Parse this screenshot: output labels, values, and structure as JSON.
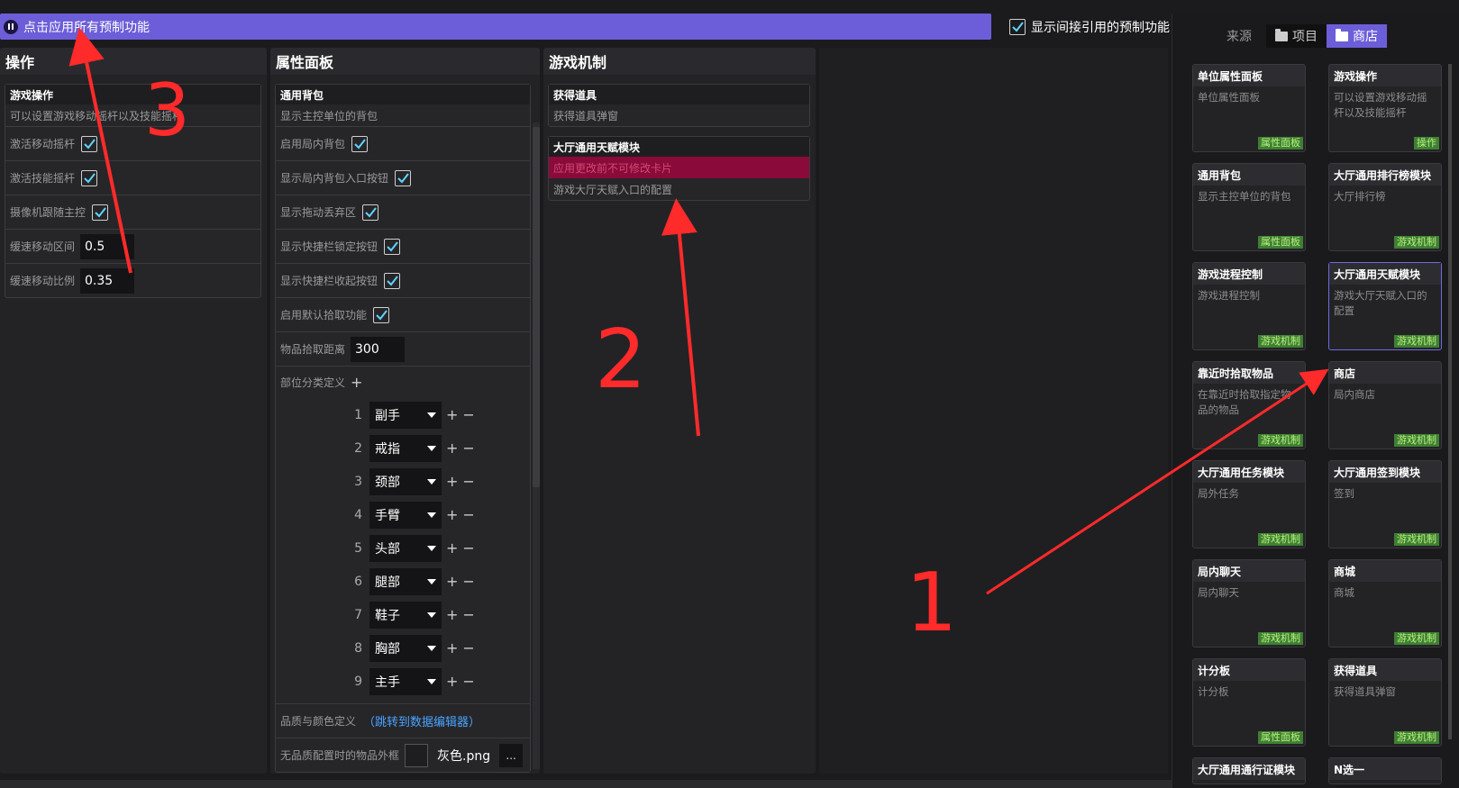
{
  "topbar": {
    "apply_all": "点击应用所有预制功能",
    "show_indirect": "显示间接引用的预制功能"
  },
  "ops": {
    "header": "操作",
    "group_title": "游戏操作",
    "group_desc": "可以设置游戏移动摇杆以及技能摇杆",
    "rows": [
      {
        "label": "激活移动摇杆"
      },
      {
        "label": "激活技能摇杆"
      },
      {
        "label": "摄像机跟随主控"
      },
      {
        "label": "缓速移动区间",
        "value": "0.5"
      },
      {
        "label": "缓速移动比例",
        "value": "0.35"
      }
    ]
  },
  "attr": {
    "header": "属性面板",
    "group_title": "通用背包",
    "group_desc": "显示主控单位的背包",
    "rows": [
      {
        "label": "启用局内背包"
      },
      {
        "label": "显示局内背包入口按钮"
      },
      {
        "label": "显示拖动丢弃区"
      },
      {
        "label": "显示快捷栏锁定按钮"
      },
      {
        "label": "显示快捷栏收起按钮"
      },
      {
        "label": "启用默认拾取功能"
      },
      {
        "label": "物品拾取距离",
        "value": "300"
      }
    ],
    "slot_label": "部位分类定义",
    "slots": [
      {
        "num": "1",
        "name": "副手"
      },
      {
        "num": "2",
        "name": "戒指"
      },
      {
        "num": "3",
        "name": "颈部"
      },
      {
        "num": "4",
        "name": "手臂"
      },
      {
        "num": "5",
        "name": "头部"
      },
      {
        "num": "6",
        "name": "腿部"
      },
      {
        "num": "7",
        "name": "鞋子"
      },
      {
        "num": "8",
        "name": "胸部"
      },
      {
        "num": "9",
        "name": "主手"
      }
    ],
    "quality_label": "品质与颜色定义",
    "quality_link": "（跳转到数据编辑器）",
    "frame_label": "无品质配置时的物品外框",
    "frame_file": "灰色.png",
    "frame_more": "..."
  },
  "mech": {
    "header": "游戏机制",
    "group1_title": "获得道具",
    "group1_desc": "获得道具弹窗",
    "group2_title": "大厅通用天赋模块",
    "group2_warning": "应用更改前不可修改卡片",
    "group2_desc": "游戏大厅天赋入口的配置"
  },
  "right": {
    "source_label": "来源",
    "tab_project": "项目",
    "tab_store": "商店",
    "cards": [
      {
        "title": "单位属性面板",
        "desc": "单位属性面板",
        "tag": "属性面板"
      },
      {
        "title": "游戏操作",
        "desc": "可以设置游戏移动摇杆以及技能摇杆",
        "tag": "操作"
      },
      {
        "title": "通用背包",
        "desc": "显示主控单位的背包",
        "tag": "属性面板"
      },
      {
        "title": "大厅通用排行榜模块",
        "desc": "大厅排行榜",
        "tag": "游戏机制"
      },
      {
        "title": "游戏进程控制",
        "desc": "游戏进程控制",
        "tag": "游戏机制"
      },
      {
        "title": "大厅通用天赋模块",
        "desc": "游戏大厅天赋入口的配置",
        "tag": "游戏机制"
      },
      {
        "title": "靠近时拾取物品",
        "desc": "在靠近时拾取指定物品的物品",
        "tag": "游戏机制"
      },
      {
        "title": "商店",
        "desc": "局内商店",
        "tag": "游戏机制"
      },
      {
        "title": "大厅通用任务模块",
        "desc": "局外任务",
        "tag": "游戏机制"
      },
      {
        "title": "大厅通用签到模块",
        "desc": "签到",
        "tag": "游戏机制"
      },
      {
        "title": "局内聊天",
        "desc": "局内聊天",
        "tag": "游戏机制"
      },
      {
        "title": "商城",
        "desc": "商城",
        "tag": "游戏机制"
      },
      {
        "title": "计分板",
        "desc": "计分板",
        "tag": "属性面板"
      },
      {
        "title": "获得道具",
        "desc": "获得道具弹窗",
        "tag": "游戏机制"
      },
      {
        "title": "大厅通用通行证模块",
        "desc": "",
        "tag": ""
      },
      {
        "title": "N选一",
        "desc": "",
        "tag": ""
      }
    ]
  },
  "annotations": {
    "n1": "1",
    "n2": "2",
    "n3": "3"
  },
  "colors": {
    "accent": "#6c5ed8",
    "tag_bg": "#3f7f34",
    "warning": "#8a0a3a",
    "annotation": "#ff2a2a"
  }
}
